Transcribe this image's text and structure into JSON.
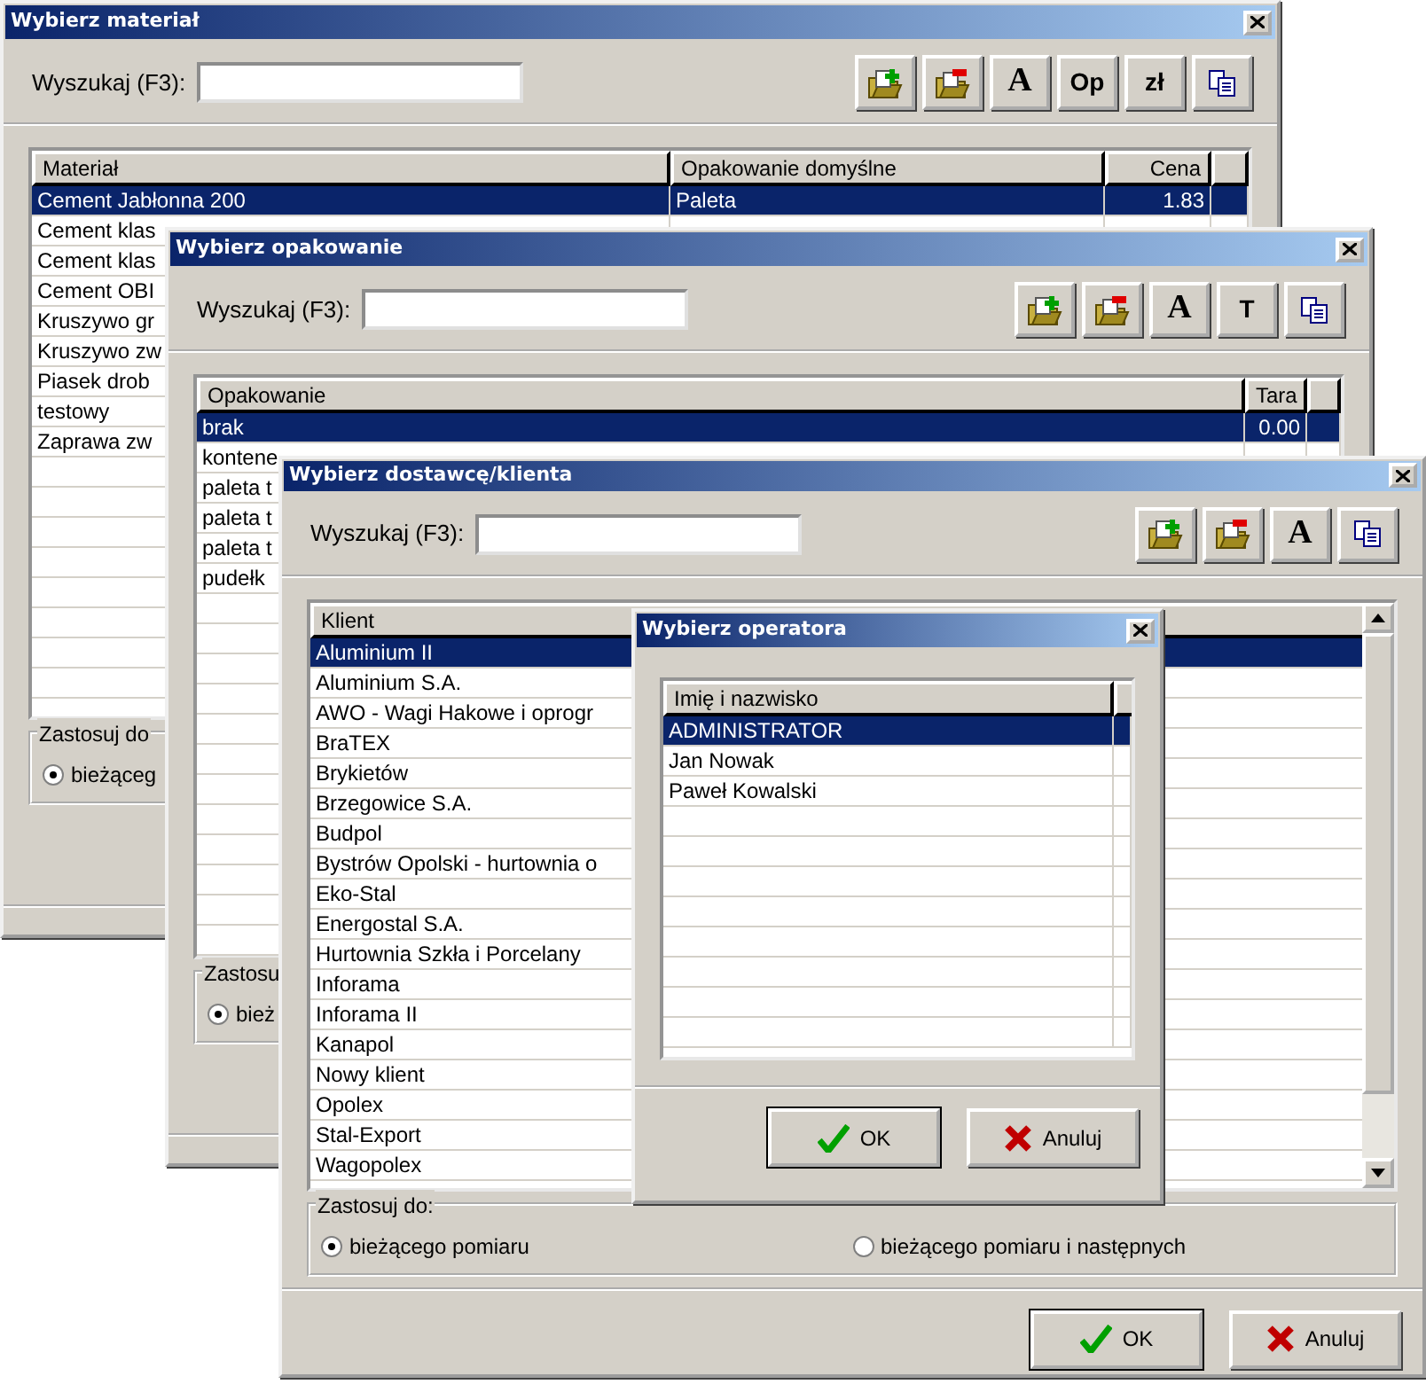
{
  "windows": [
    {
      "title": "Wybierz materiał",
      "search": {
        "label": "Wyszukaj (F3):"
      },
      "toolbar": [
        {
          "kind": "add"
        },
        {
          "kind": "edit"
        },
        {
          "kind": "text",
          "label": "A"
        },
        {
          "kind": "text",
          "label": "Op"
        },
        {
          "kind": "text",
          "label": "zł"
        },
        {
          "kind": "copy"
        }
      ],
      "table": {
        "columns": [
          "Materiał",
          "Opakowanie domyślne",
          "Cena"
        ],
        "rows": [
          {
            "cells": [
              "Cement Jabłonna 200",
              "Paleta",
              "1.83"
            ],
            "selected": true
          },
          {
            "cells": [
              "Cement klas"
            ],
            "selected": false
          },
          {
            "cells": [
              "Cement klas"
            ],
            "selected": false
          },
          {
            "cells": [
              "Cement OBI"
            ],
            "selected": false
          },
          {
            "cells": [
              "Kruszywo gr"
            ],
            "selected": false
          },
          {
            "cells": [
              "Kruszywo zw"
            ],
            "selected": false
          },
          {
            "cells": [
              "Piasek drob"
            ],
            "selected": false
          },
          {
            "cells": [
              "testowy"
            ],
            "selected": false
          },
          {
            "cells": [
              "Zaprawa zw"
            ],
            "selected": false
          }
        ]
      },
      "apply": {
        "legend": "Zastosuj do",
        "options": [
          {
            "label": "bieżąceg",
            "selected": true
          }
        ]
      }
    },
    {
      "title": "Wybierz opakowanie",
      "search": {
        "label": "Wyszukaj (F3):"
      },
      "toolbar": [
        {
          "kind": "add"
        },
        {
          "kind": "edit"
        },
        {
          "kind": "text",
          "label": "A"
        },
        {
          "kind": "text",
          "label": "T"
        },
        {
          "kind": "copy"
        }
      ],
      "table": {
        "columns": [
          "Opakowanie",
          "Tara"
        ],
        "rows": [
          {
            "cells": [
              "brak",
              "0.00"
            ],
            "selected": true
          },
          {
            "cells": [
              "kontene"
            ],
            "selected": false
          },
          {
            "cells": [
              "paleta t"
            ],
            "selected": false
          },
          {
            "cells": [
              "paleta t"
            ],
            "selected": false
          },
          {
            "cells": [
              "paleta t"
            ],
            "selected": false
          },
          {
            "cells": [
              "pudełk"
            ],
            "selected": false
          }
        ]
      },
      "apply": {
        "legend": "Zastosu",
        "options": [
          {
            "label": "bież",
            "selected": true
          }
        ]
      }
    },
    {
      "title": "Wybierz dostawcę/klienta",
      "search": {
        "label": "Wyszukaj (F3):"
      },
      "toolbar": [
        {
          "kind": "add"
        },
        {
          "kind": "edit"
        },
        {
          "kind": "text",
          "label": "A"
        },
        {
          "kind": "copy"
        }
      ],
      "table": {
        "columns": [
          "Klient"
        ],
        "rows": [
          {
            "cells": [
              "Aluminium II"
            ],
            "selected": true
          },
          {
            "cells": [
              "Aluminium S.A."
            ],
            "selected": false
          },
          {
            "cells": [
              "AWO - Wagi Hakowe i oprogr"
            ],
            "selected": false
          },
          {
            "cells": [
              "BraTEX"
            ],
            "selected": false
          },
          {
            "cells": [
              "Brykietów"
            ],
            "selected": false
          },
          {
            "cells": [
              "Brzegowice S.A."
            ],
            "selected": false
          },
          {
            "cells": [
              "Budpol"
            ],
            "selected": false
          },
          {
            "cells": [
              "Bystrów Opolski - hurtownia o"
            ],
            "selected": false
          },
          {
            "cells": [
              "Eko-Stal"
            ],
            "selected": false
          },
          {
            "cells": [
              "Energostal S.A."
            ],
            "selected": false
          },
          {
            "cells": [
              "Hurtownia Szkła i Porcelany"
            ],
            "selected": false
          },
          {
            "cells": [
              "Inforama"
            ],
            "selected": false
          },
          {
            "cells": [
              "Inforama II"
            ],
            "selected": false
          },
          {
            "cells": [
              "Kanapol"
            ],
            "selected": false
          },
          {
            "cells": [
              "Nowy klient"
            ],
            "selected": false
          },
          {
            "cells": [
              "Opolex"
            ],
            "selected": false
          },
          {
            "cells": [
              "Stal-Export"
            ],
            "selected": false
          },
          {
            "cells": [
              "Wagopolex"
            ],
            "selected": false
          }
        ]
      },
      "apply": {
        "legend": "Zastosuj do:",
        "options": [
          {
            "label": "bieżącego pomiaru",
            "selected": true
          },
          {
            "label": "bieżącego pomiaru i następnych",
            "selected": false
          }
        ]
      },
      "buttons": [
        {
          "kind": "ok",
          "label": "OK"
        },
        {
          "kind": "cancel",
          "label": "Anuluj"
        }
      ]
    },
    {
      "title": "Wybierz operatora",
      "table": {
        "columns": [
          "Imię i nazwisko"
        ],
        "rows": [
          {
            "cells": [
              "ADMINISTRATOR"
            ],
            "selected": true
          },
          {
            "cells": [
              "Jan Nowak"
            ],
            "selected": false
          },
          {
            "cells": [
              "Paweł Kowalski"
            ],
            "selected": false
          }
        ]
      },
      "buttons": [
        {
          "kind": "ok",
          "label": "OK"
        },
        {
          "kind": "cancel",
          "label": "Anuluj"
        }
      ]
    }
  ]
}
